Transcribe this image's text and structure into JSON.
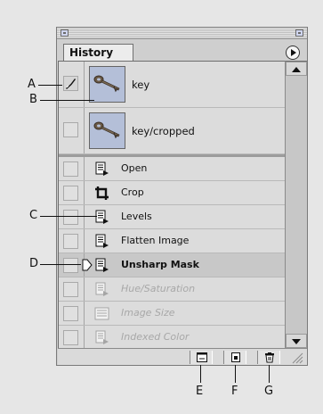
{
  "palette": {
    "tab_title": "History",
    "menu_icon": "palette-menu-arrow-icon"
  },
  "snapshots": [
    {
      "label": "key",
      "icon": "key-thumbnail"
    },
    {
      "label": "key/cropped",
      "icon": "key-thumbnail"
    }
  ],
  "steps": [
    {
      "label": "Open",
      "state": "normal",
      "icon": "history-state-icon"
    },
    {
      "label": "Crop",
      "state": "normal",
      "icon": "crop-icon"
    },
    {
      "label": "Levels",
      "state": "normal",
      "icon": "history-state-icon"
    },
    {
      "label": "Flatten Image",
      "state": "normal",
      "icon": "history-state-icon"
    },
    {
      "label": "Unsharp Mask",
      "state": "current",
      "icon": "history-state-icon"
    },
    {
      "label": "Hue/Saturation",
      "state": "undone",
      "icon": "history-state-icon"
    },
    {
      "label": "Image Size",
      "state": "undone",
      "icon": "image-size-icon"
    },
    {
      "label": "Indexed Color",
      "state": "undone",
      "icon": "history-state-icon"
    }
  ],
  "bottom_buttons": [
    {
      "name": "new-document-button",
      "icon": "new-document-icon"
    },
    {
      "name": "new-snapshot-button",
      "icon": "new-snapshot-icon"
    },
    {
      "name": "delete-button",
      "icon": "trash-icon"
    }
  ],
  "callouts": {
    "A": "A",
    "B": "B",
    "C": "C",
    "D": "D",
    "E": "E",
    "F": "F",
    "G": "G"
  },
  "colors": {
    "thumbnail_bg": "#b4bfd8",
    "panel_bg": "#dcdcdc",
    "current_row": "#c8c8c8",
    "undone_text": "#a8a8a8"
  }
}
